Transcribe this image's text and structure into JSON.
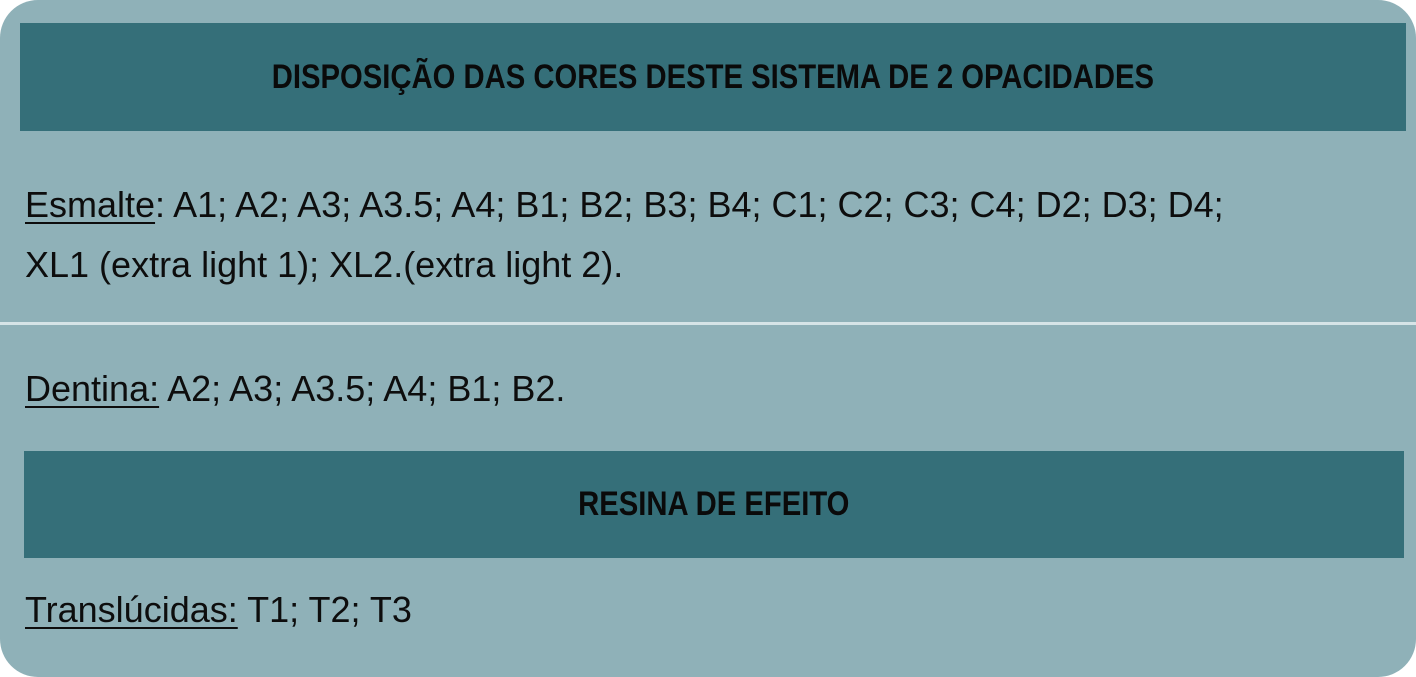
{
  "header": {
    "title": "DISPOSIÇÃO DAS CORES DESTE SISTEMA DE 2 OPACIDADES"
  },
  "esmalte": {
    "label": "Esmalte",
    "separator": ":",
    "values_line1": " A1; A2; A3; A3.5; A4; B1; B2; B3; B4; C1; C2; C3; C4; D2; D3; D4;",
    "values_line2": "XL1 (extra light 1); XL2.(extra light 2)."
  },
  "dentina": {
    "label": "Dentina:",
    "values": " A2; A3; A3.5; A4; B1; B2."
  },
  "effect_section": {
    "title": "RESINA DE EFEITO"
  },
  "translucidas": {
    "label": "Translúcidas:",
    "values": " T1; T2; T3"
  },
  "colors": {
    "card_background": "#8fb1b8",
    "banner_background": "#356f79",
    "divider": "#d6e4e7"
  }
}
